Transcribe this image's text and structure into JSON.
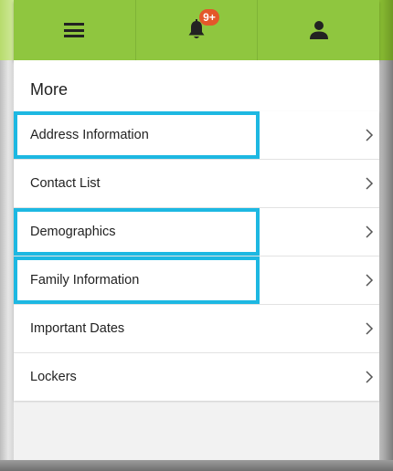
{
  "nav": {
    "menu_icon": "hamburger-icon",
    "notifications_icon": "bell-icon",
    "notifications_badge": "9+",
    "profile_icon": "user-icon"
  },
  "page": {
    "title": "More"
  },
  "menu": {
    "items": [
      {
        "label": "Address Information",
        "highlighted": true
      },
      {
        "label": "Contact List",
        "highlighted": false
      },
      {
        "label": "Demographics",
        "highlighted": true
      },
      {
        "label": "Family Information",
        "highlighted": true
      },
      {
        "label": "Important Dates",
        "highlighted": false
      },
      {
        "label": "Lockers",
        "highlighted": false
      }
    ],
    "chevron_icon": "chevron-right-icon"
  },
  "colors": {
    "nav_green": "#8fc63f",
    "badge_orange": "#e4572a",
    "highlight_cyan": "#1db8e2"
  }
}
